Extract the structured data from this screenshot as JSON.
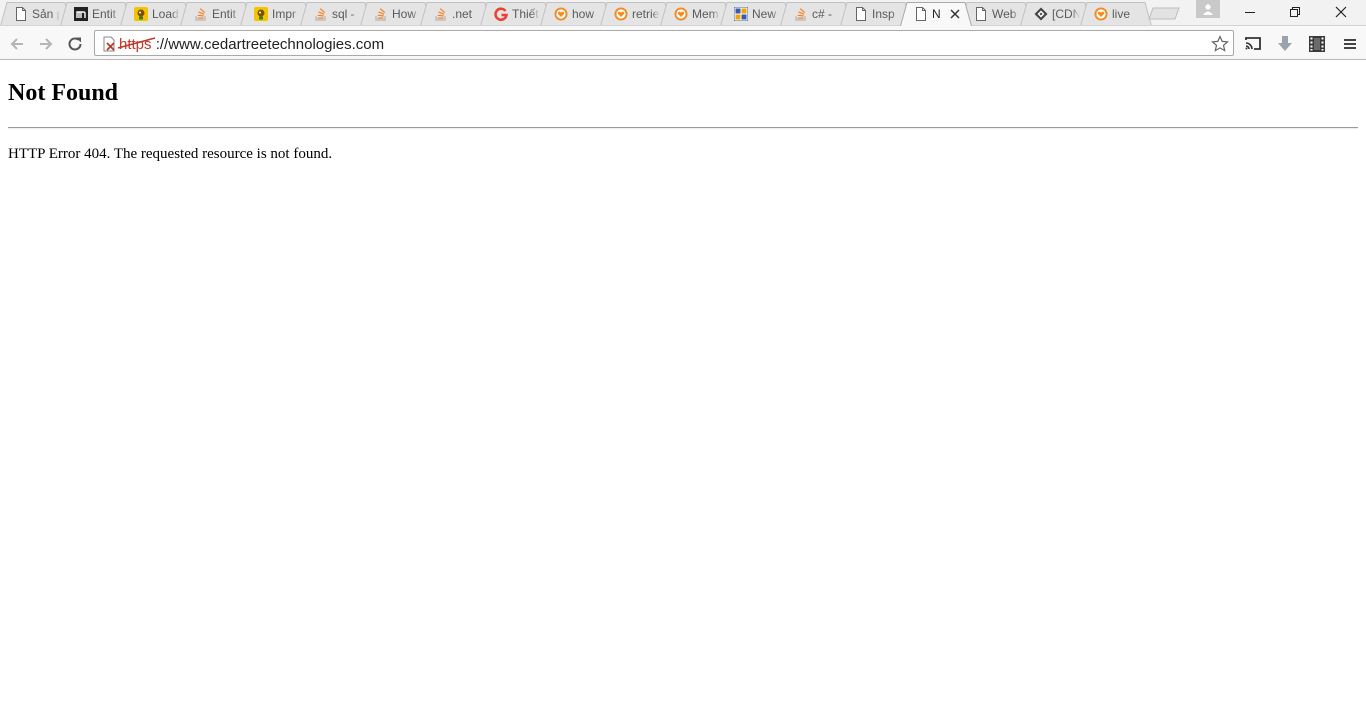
{
  "browser": {
    "tabs": [
      {
        "title": "Sản p",
        "icon": "page-icon"
      },
      {
        "title": "Entit",
        "icon": "m-icon"
      },
      {
        "title": "Load",
        "icon": "codeproject-icon"
      },
      {
        "title": "Entit",
        "icon": "stackoverflow-icon"
      },
      {
        "title": "Impr",
        "icon": "codeproject-icon"
      },
      {
        "title": "sql -",
        "icon": "stackoverflow-icon"
      },
      {
        "title": "How",
        "icon": "stackoverflow-icon"
      },
      {
        "title": ".net",
        "icon": "stackoverflow-icon"
      },
      {
        "title": "Thiết",
        "icon": "google-g-icon"
      },
      {
        "title": "how",
        "icon": "heart-icon"
      },
      {
        "title": "retrie",
        "icon": "heart-icon"
      },
      {
        "title": "Mem",
        "icon": "heart-icon"
      },
      {
        "title": "New",
        "icon": "grid-icon"
      },
      {
        "title": "c# -",
        "icon": "stackoverflow-icon"
      },
      {
        "title": "Insp",
        "icon": "page-icon"
      },
      {
        "title": "N",
        "icon": "page-icon",
        "active": true
      },
      {
        "title": "Web",
        "icon": "page-icon"
      },
      {
        "title": "[CDN",
        "icon": "diamond-icon"
      },
      {
        "title": "live",
        "icon": "heart-icon"
      }
    ],
    "address": {
      "scheme": "https",
      "rest": "://www.cedartreetechnologies.com"
    }
  },
  "page": {
    "heading": "Not Found",
    "message": "HTTP Error 404. The requested resource is not found."
  },
  "colors": {
    "stackoverflow": "#f48024",
    "heart": "#f58a1f",
    "google": "#e94235",
    "insecure": "#c0392b"
  }
}
